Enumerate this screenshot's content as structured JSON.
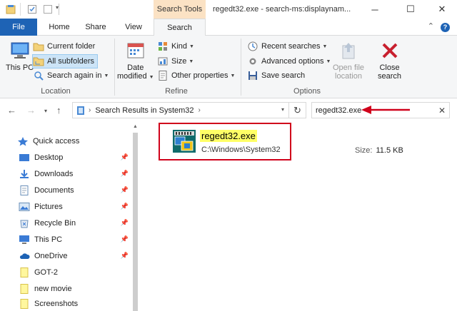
{
  "window": {
    "title": "regedt32.exe - search-ms:displaynam...",
    "context_tab": "Search Tools",
    "controls": {
      "minimize": "─",
      "maximize": "☐",
      "close": "✕"
    }
  },
  "tabs": [
    {
      "label": "File"
    },
    {
      "label": "Home"
    },
    {
      "label": "Share"
    },
    {
      "label": "View"
    },
    {
      "label": "Search"
    }
  ],
  "ribbon": {
    "location": {
      "label": "Location",
      "this_pc": "This PC",
      "current_folder": "Current folder",
      "all_subfolders": "All subfolders",
      "search_again_in": "Search again in"
    },
    "refine": {
      "label": "Refine",
      "date_modified_line1": "Date",
      "date_modified_line2": "modified",
      "kind": "Kind",
      "size": "Size",
      "other_properties": "Other properties"
    },
    "options": {
      "label": "Options",
      "recent_searches": "Recent searches",
      "advanced_options": "Advanced options",
      "save_search": "Save search",
      "open_file_location_line1": "Open file",
      "open_file_location_line2": "location",
      "close_search_line1": "Close",
      "close_search_line2": "search"
    }
  },
  "address": {
    "path": "Search Results in System32",
    "search_value": "regedt32.exe"
  },
  "navpane": {
    "items": [
      {
        "label": "Quick access",
        "icon": "star-icon",
        "pinned": false
      },
      {
        "label": "Desktop",
        "icon": "desktop-icon",
        "pinned": true
      },
      {
        "label": "Downloads",
        "icon": "download-icon",
        "pinned": true
      },
      {
        "label": "Documents",
        "icon": "documents-icon",
        "pinned": true
      },
      {
        "label": "Pictures",
        "icon": "pictures-icon",
        "pinned": true
      },
      {
        "label": "Recycle Bin",
        "icon": "recycle-bin-icon",
        "pinned": true
      },
      {
        "label": "This PC",
        "icon": "computer-icon",
        "pinned": true
      },
      {
        "label": "OneDrive",
        "icon": "cloud-icon",
        "pinned": true
      },
      {
        "label": "GOT-2",
        "icon": "folder-icon",
        "pinned": false
      },
      {
        "label": "new movie",
        "icon": "folder-icon",
        "pinned": false
      },
      {
        "label": "Screenshots",
        "icon": "folder-icon",
        "pinned": false
      }
    ]
  },
  "result": {
    "name": "regedt32.exe",
    "path": "C:\\Windows\\System32",
    "size_label": "Size:",
    "size_value": "11.5 KB"
  },
  "colors": {
    "file_tab": "#1e63b5",
    "context_tab": "#fbe2c4",
    "highlight_box": "#d0021b",
    "name_highlight": "#ffff66"
  }
}
